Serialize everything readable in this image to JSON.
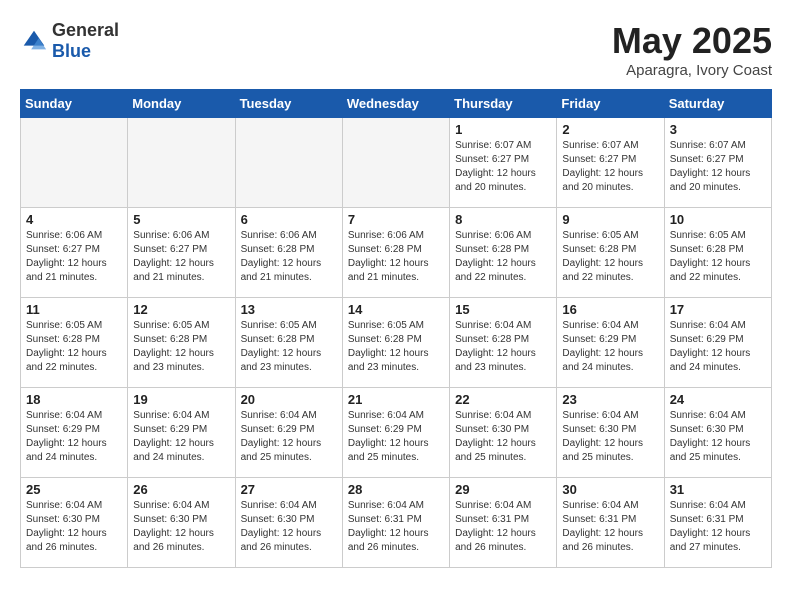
{
  "header": {
    "logo_general": "General",
    "logo_blue": "Blue",
    "month": "May 2025",
    "location": "Aparagra, Ivory Coast"
  },
  "weekdays": [
    "Sunday",
    "Monday",
    "Tuesday",
    "Wednesday",
    "Thursday",
    "Friday",
    "Saturday"
  ],
  "weeks": [
    [
      {
        "day": "",
        "empty": true
      },
      {
        "day": "",
        "empty": true
      },
      {
        "day": "",
        "empty": true
      },
      {
        "day": "",
        "empty": true
      },
      {
        "day": "1",
        "sunrise": "6:07 AM",
        "sunset": "6:27 PM",
        "daylight": "12 hours and 20 minutes."
      },
      {
        "day": "2",
        "sunrise": "6:07 AM",
        "sunset": "6:27 PM",
        "daylight": "12 hours and 20 minutes."
      },
      {
        "day": "3",
        "sunrise": "6:07 AM",
        "sunset": "6:27 PM",
        "daylight": "12 hours and 20 minutes."
      }
    ],
    [
      {
        "day": "4",
        "sunrise": "6:06 AM",
        "sunset": "6:27 PM",
        "daylight": "12 hours and 21 minutes."
      },
      {
        "day": "5",
        "sunrise": "6:06 AM",
        "sunset": "6:27 PM",
        "daylight": "12 hours and 21 minutes."
      },
      {
        "day": "6",
        "sunrise": "6:06 AM",
        "sunset": "6:28 PM",
        "daylight": "12 hours and 21 minutes."
      },
      {
        "day": "7",
        "sunrise": "6:06 AM",
        "sunset": "6:28 PM",
        "daylight": "12 hours and 21 minutes."
      },
      {
        "day": "8",
        "sunrise": "6:06 AM",
        "sunset": "6:28 PM",
        "daylight": "12 hours and 22 minutes."
      },
      {
        "day": "9",
        "sunrise": "6:05 AM",
        "sunset": "6:28 PM",
        "daylight": "12 hours and 22 minutes."
      },
      {
        "day": "10",
        "sunrise": "6:05 AM",
        "sunset": "6:28 PM",
        "daylight": "12 hours and 22 minutes."
      }
    ],
    [
      {
        "day": "11",
        "sunrise": "6:05 AM",
        "sunset": "6:28 PM",
        "daylight": "12 hours and 22 minutes."
      },
      {
        "day": "12",
        "sunrise": "6:05 AM",
        "sunset": "6:28 PM",
        "daylight": "12 hours and 23 minutes."
      },
      {
        "day": "13",
        "sunrise": "6:05 AM",
        "sunset": "6:28 PM",
        "daylight": "12 hours and 23 minutes."
      },
      {
        "day": "14",
        "sunrise": "6:05 AM",
        "sunset": "6:28 PM",
        "daylight": "12 hours and 23 minutes."
      },
      {
        "day": "15",
        "sunrise": "6:04 AM",
        "sunset": "6:28 PM",
        "daylight": "12 hours and 23 minutes."
      },
      {
        "day": "16",
        "sunrise": "6:04 AM",
        "sunset": "6:29 PM",
        "daylight": "12 hours and 24 minutes."
      },
      {
        "day": "17",
        "sunrise": "6:04 AM",
        "sunset": "6:29 PM",
        "daylight": "12 hours and 24 minutes."
      }
    ],
    [
      {
        "day": "18",
        "sunrise": "6:04 AM",
        "sunset": "6:29 PM",
        "daylight": "12 hours and 24 minutes."
      },
      {
        "day": "19",
        "sunrise": "6:04 AM",
        "sunset": "6:29 PM",
        "daylight": "12 hours and 24 minutes."
      },
      {
        "day": "20",
        "sunrise": "6:04 AM",
        "sunset": "6:29 PM",
        "daylight": "12 hours and 25 minutes."
      },
      {
        "day": "21",
        "sunrise": "6:04 AM",
        "sunset": "6:29 PM",
        "daylight": "12 hours and 25 minutes."
      },
      {
        "day": "22",
        "sunrise": "6:04 AM",
        "sunset": "6:30 PM",
        "daylight": "12 hours and 25 minutes."
      },
      {
        "day": "23",
        "sunrise": "6:04 AM",
        "sunset": "6:30 PM",
        "daylight": "12 hours and 25 minutes."
      },
      {
        "day": "24",
        "sunrise": "6:04 AM",
        "sunset": "6:30 PM",
        "daylight": "12 hours and 25 minutes."
      }
    ],
    [
      {
        "day": "25",
        "sunrise": "6:04 AM",
        "sunset": "6:30 PM",
        "daylight": "12 hours and 26 minutes."
      },
      {
        "day": "26",
        "sunrise": "6:04 AM",
        "sunset": "6:30 PM",
        "daylight": "12 hours and 26 minutes."
      },
      {
        "day": "27",
        "sunrise": "6:04 AM",
        "sunset": "6:30 PM",
        "daylight": "12 hours and 26 minutes."
      },
      {
        "day": "28",
        "sunrise": "6:04 AM",
        "sunset": "6:31 PM",
        "daylight": "12 hours and 26 minutes."
      },
      {
        "day": "29",
        "sunrise": "6:04 AM",
        "sunset": "6:31 PM",
        "daylight": "12 hours and 26 minutes."
      },
      {
        "day": "30",
        "sunrise": "6:04 AM",
        "sunset": "6:31 PM",
        "daylight": "12 hours and 26 minutes."
      },
      {
        "day": "31",
        "sunrise": "6:04 AM",
        "sunset": "6:31 PM",
        "daylight": "12 hours and 27 minutes."
      }
    ]
  ],
  "labels": {
    "sunrise": "Sunrise:",
    "sunset": "Sunset:",
    "daylight": "Daylight:"
  }
}
